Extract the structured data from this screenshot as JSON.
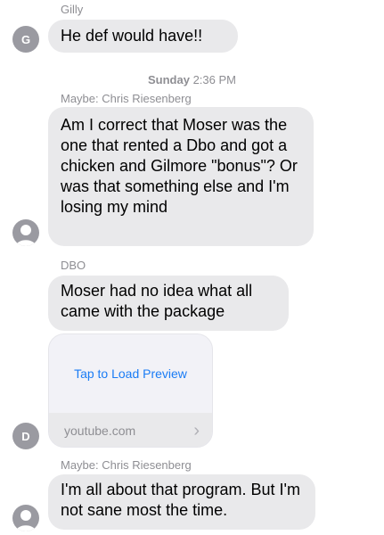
{
  "messages": [
    {
      "sender": "Gilly",
      "avatar_letter": "G",
      "text": "He def would have!!"
    },
    {
      "sender": "Maybe: Chris Riesenberg",
      "text": "Am I correct that Moser was the one that rented a Dbo and got a chicken and Gilmore \"bonus\"? Or was that something else and I'm losing my mind"
    },
    {
      "sender": "DBO",
      "avatar_letter": "D",
      "text": "Moser had no idea what all came with the package"
    },
    {
      "sender": "Maybe: Chris Riesenberg",
      "text": "I'm all about that program. But I'm not sane most the time."
    }
  ],
  "timestamp": {
    "day": "Sunday",
    "time": "2:36 PM"
  },
  "link_preview": {
    "action": "Tap to Load Preview",
    "domain": "youtube.com",
    "chevron_icon": "chevron-right-icon"
  },
  "avatar_icon": "person-silhouette-icon"
}
